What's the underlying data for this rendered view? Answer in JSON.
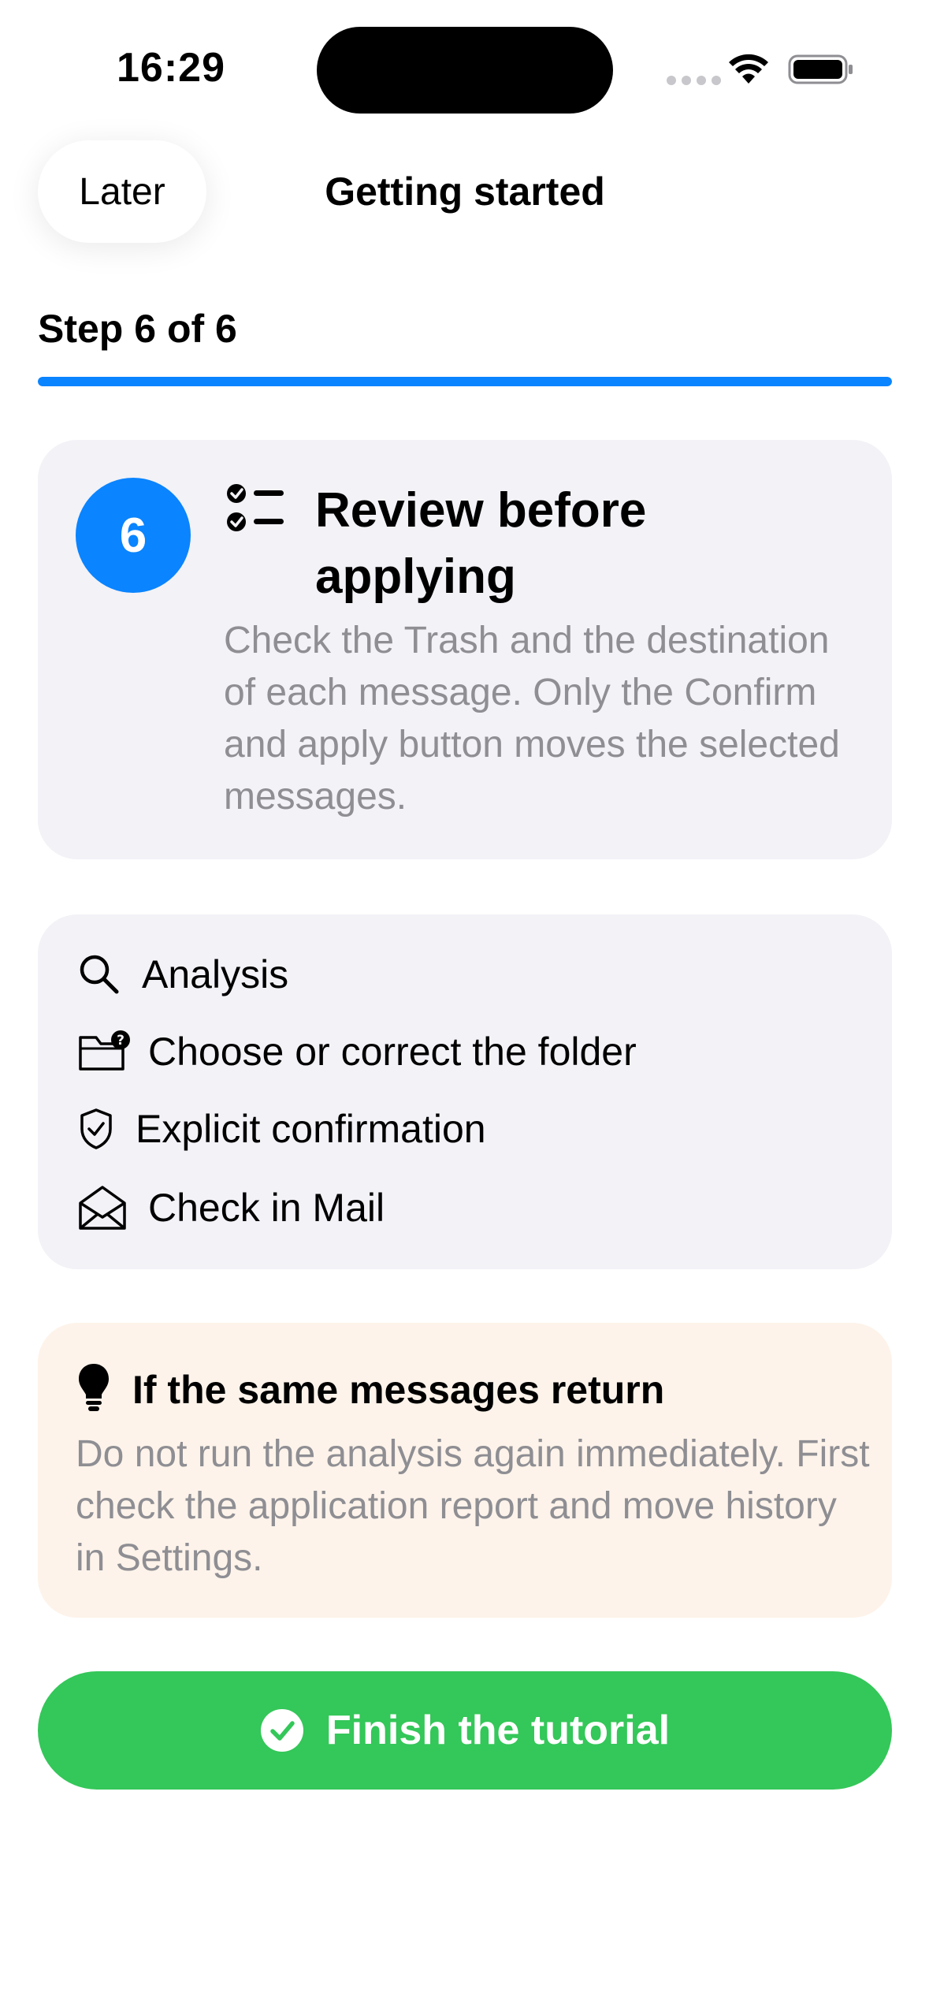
{
  "status_bar": {
    "time": "16:29"
  },
  "nav": {
    "later_label": "Later",
    "title": "Getting started"
  },
  "progress": {
    "label": "Step 6 of 6",
    "fraction": 1.0,
    "color": "#0a84ff"
  },
  "step": {
    "number": "6",
    "icon": "checklist-icon",
    "title": "Review before applying",
    "description": "Check the Trash and the destination of each message. Only the Confirm and apply button moves the selected messages."
  },
  "features": [
    {
      "icon": "magnifying-glass-icon",
      "label": "Analysis"
    },
    {
      "icon": "folder-question-icon",
      "label": "Choose or correct the folder"
    },
    {
      "icon": "shield-check-icon",
      "label": "Explicit confirmation"
    },
    {
      "icon": "open-envelope-icon",
      "label": "Check in Mail"
    }
  ],
  "tip": {
    "icon": "lightbulb-icon",
    "title": "If the same messages return",
    "body": "Do not run the analysis again immediately. First check the application report and move history in Settings."
  },
  "finish": {
    "icon": "checkmark-circle-icon",
    "label": "Finish the tutorial",
    "color": "#34c759"
  }
}
